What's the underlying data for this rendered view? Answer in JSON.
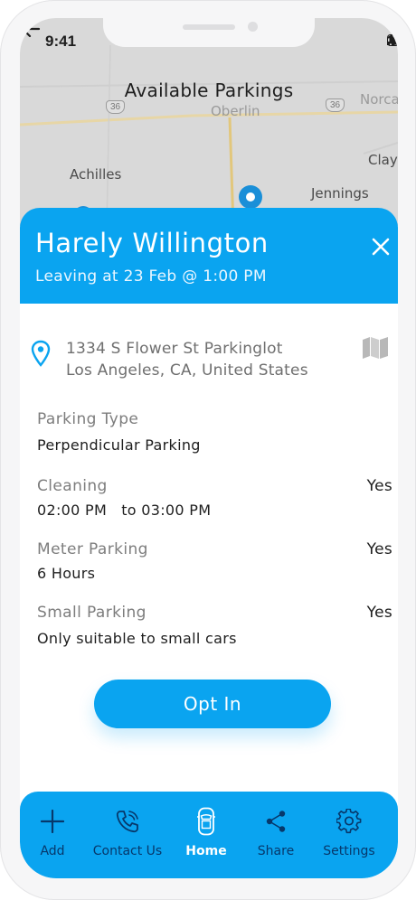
{
  "status_bar": {
    "time": "9:41"
  },
  "header_bar": {
    "title": "Available Parkings"
  },
  "map": {
    "labels": [
      "Achilles",
      "Oberlin",
      "Clay",
      "Jennings",
      "Norca"
    ],
    "shields": [
      "36",
      "36"
    ]
  },
  "card": {
    "name": "Harely Willington",
    "leaving": "Leaving at 23 Feb @ 1:00 PM",
    "address_line1": "1334 S Flower St Parkinglot",
    "address_line2": "Los Angeles, CA, United States"
  },
  "details": {
    "parking_type": {
      "label": "Parking Type",
      "value": "Perpendicular Parking"
    },
    "cleaning": {
      "label": "Cleaning",
      "value": "02:00 PM   to 03:00 PM",
      "flag": "Yes"
    },
    "meter_parking": {
      "label": "Meter Parking",
      "value": "6 Hours",
      "flag": "Yes"
    },
    "small_parking": {
      "label": "Small Parking",
      "value": "Only suitable to small cars",
      "flag": "Yes"
    }
  },
  "actions": {
    "opt_in": "Opt In"
  },
  "tabs": [
    {
      "label": "Add",
      "icon": "plus-icon"
    },
    {
      "label": "Contact Us",
      "icon": "phone-icon"
    },
    {
      "label": "Home",
      "icon": "car-icon",
      "active": true
    },
    {
      "label": "Share",
      "icon": "share-icon"
    },
    {
      "label": "Settings",
      "icon": "gear-icon"
    }
  ],
  "colors": {
    "accent": "#0aa4f0",
    "tab_inactive": "#07386b",
    "map": "#d9d9d9"
  }
}
